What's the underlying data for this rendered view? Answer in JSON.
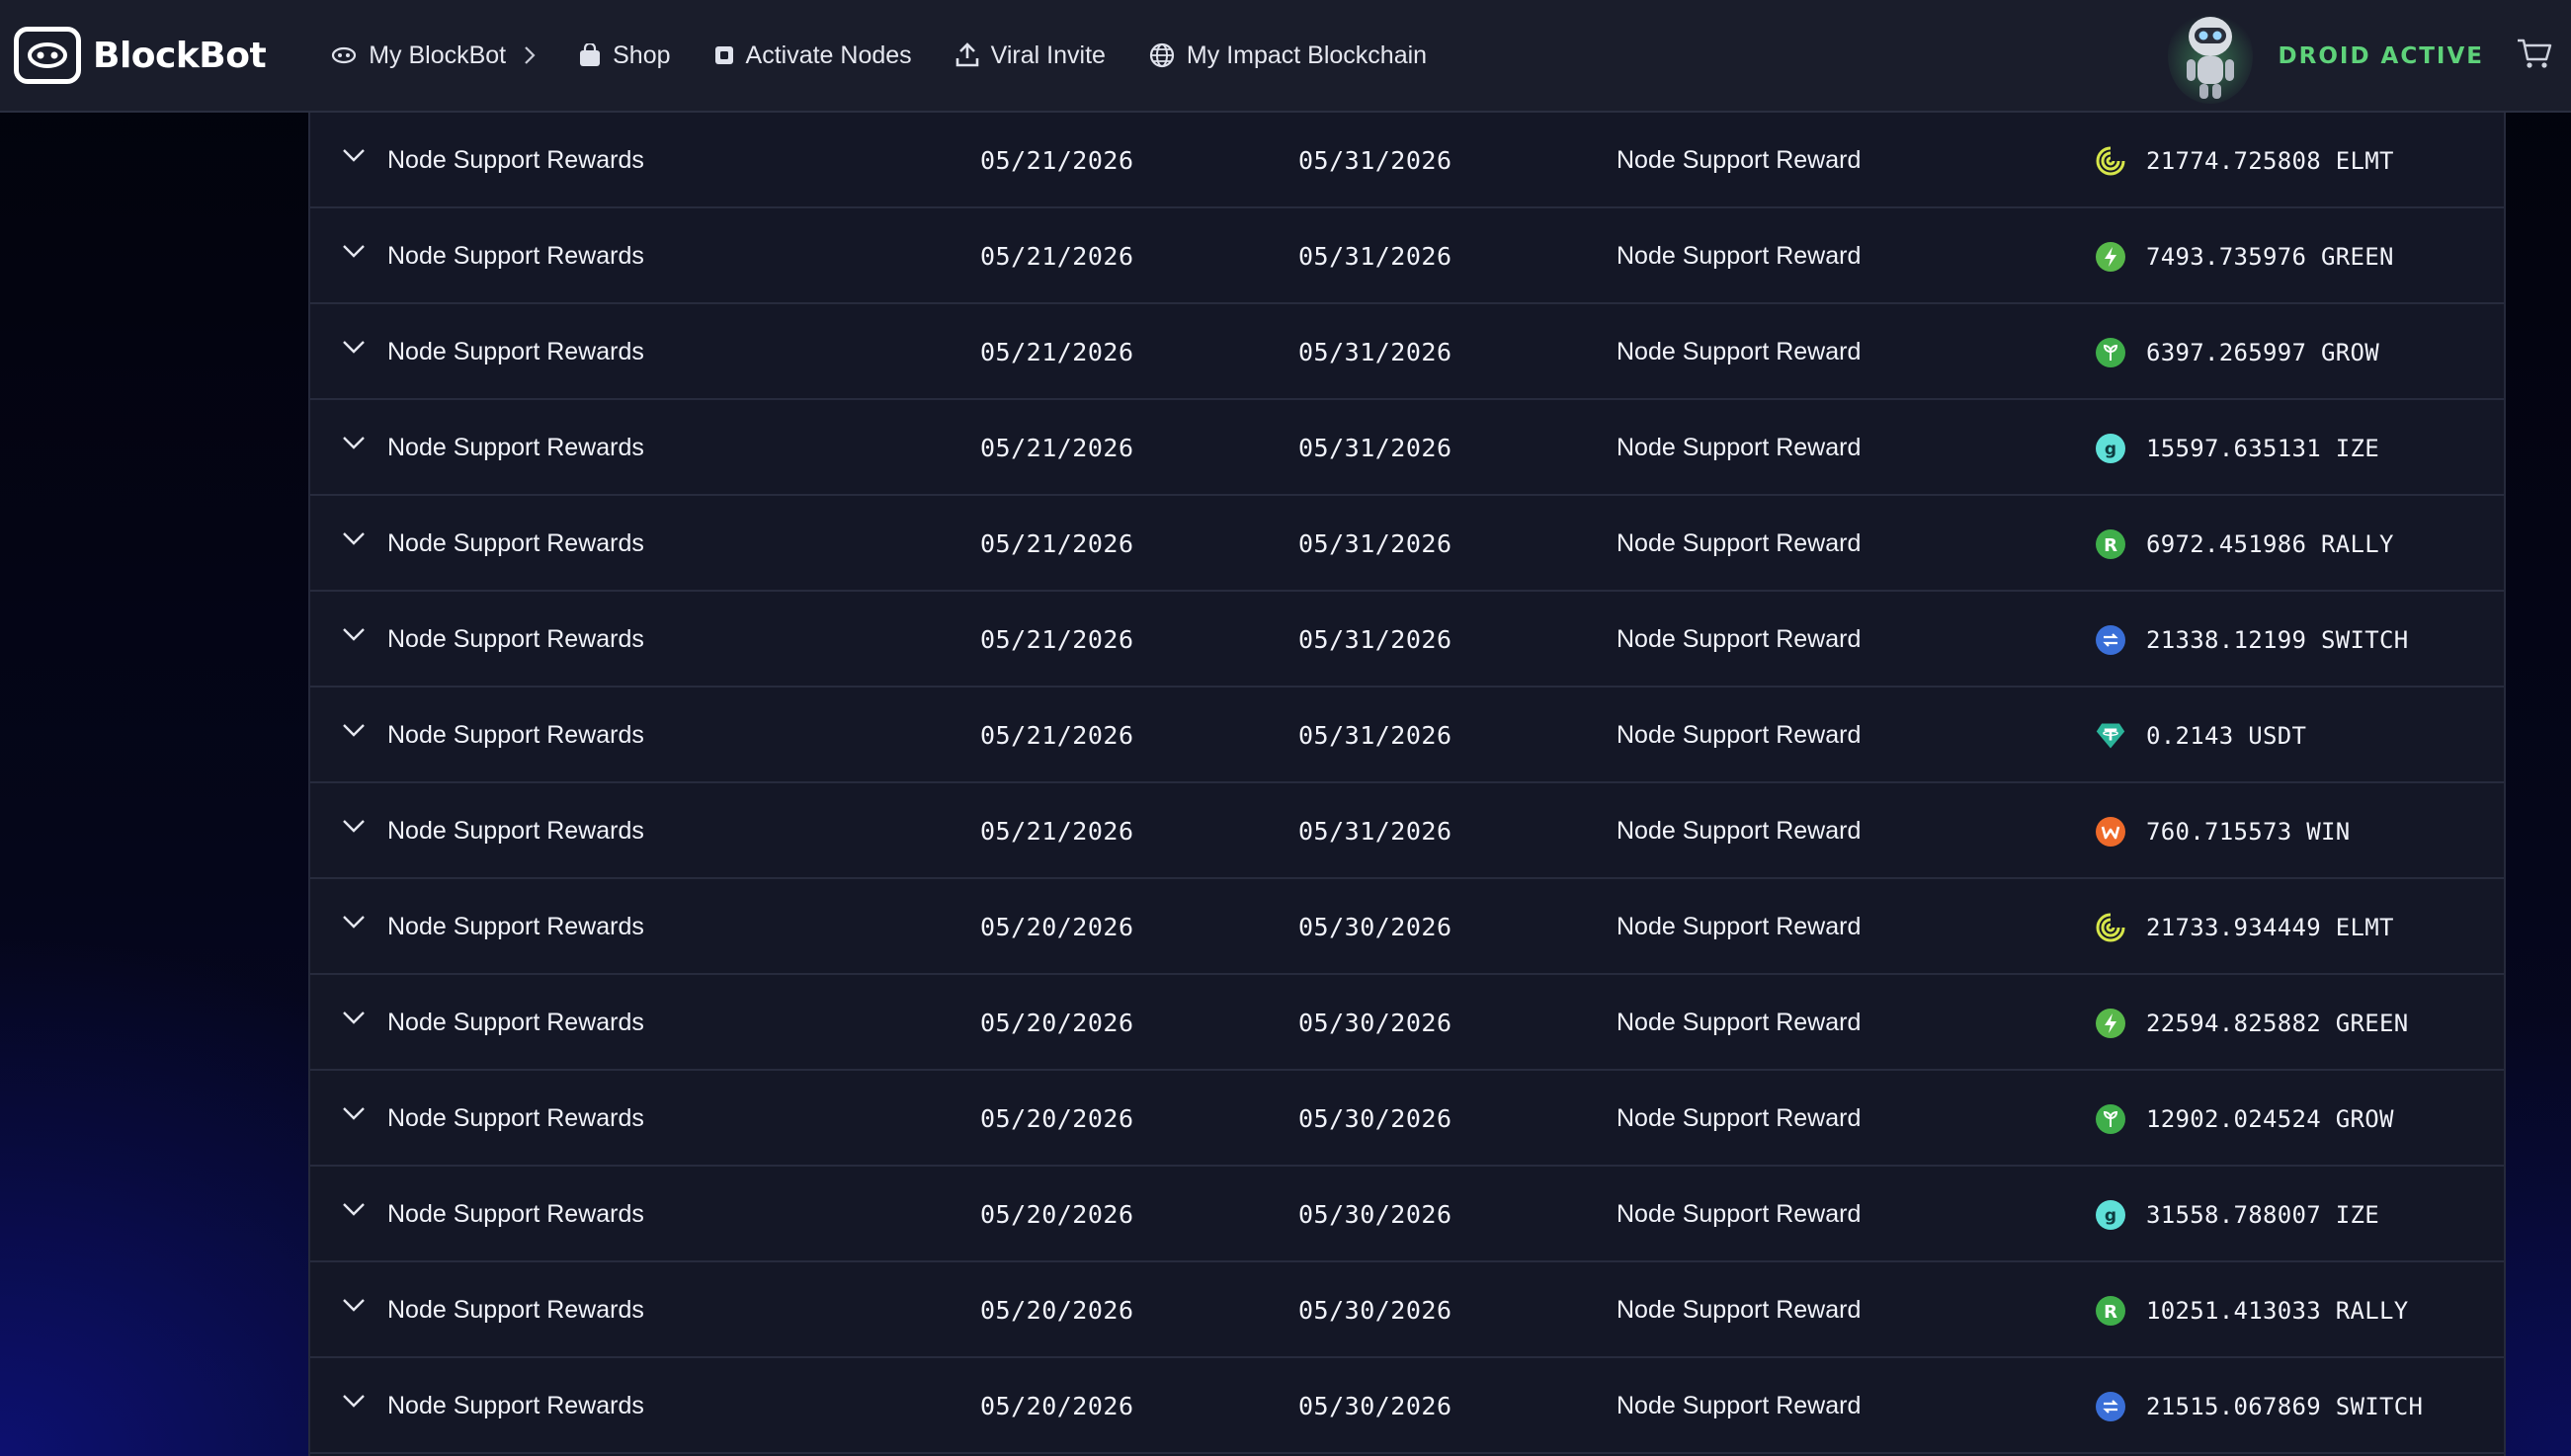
{
  "app": {
    "brand": "BlockBot"
  },
  "nav": {
    "items": [
      {
        "label": "My BlockBot",
        "icon": "eye-icon"
      },
      {
        "label": "Shop",
        "icon": "shopping-bag-icon"
      },
      {
        "label": "Activate Nodes",
        "icon": "node-chip-icon"
      },
      {
        "label": "Viral Invite",
        "icon": "upload-share-icon"
      },
      {
        "label": "My Impact Blockchain",
        "icon": "globe-icon"
      }
    ]
  },
  "status": {
    "droid": "DROID ACTIVE",
    "droid_color": "#5ed27a"
  },
  "colors": {
    "topbar": "#1a1d2b",
    "table": "#141726",
    "ELMT": "#d6e64a",
    "GREEN": "#58b84a",
    "GROW": "#3fae4a",
    "IZE": "#5fe0d8",
    "RALLY": "#3fae4a",
    "SWITCH": "#3a6fd8",
    "USDT": "#2bb59a",
    "WIN": "#ee6a2a"
  },
  "rows": [
    {
      "name": "Node Support Rewards",
      "start": "05/21/2026",
      "end": "05/31/2026",
      "type": "Node Support Reward",
      "amount": "21774.725808 ELMT",
      "token": "ELMT",
      "icon": "elmt-token-icon"
    },
    {
      "name": "Node Support Rewards",
      "start": "05/21/2026",
      "end": "05/31/2026",
      "type": "Node Support Reward",
      "amount": "7493.735976 GREEN",
      "token": "GREEN",
      "icon": "green-token-icon"
    },
    {
      "name": "Node Support Rewards",
      "start": "05/21/2026",
      "end": "05/31/2026",
      "type": "Node Support Reward",
      "amount": "6397.265997 GROW",
      "token": "GROW",
      "icon": "grow-token-icon"
    },
    {
      "name": "Node Support Rewards",
      "start": "05/21/2026",
      "end": "05/31/2026",
      "type": "Node Support Reward",
      "amount": "15597.635131 IZE",
      "token": "IZE",
      "icon": "ize-token-icon"
    },
    {
      "name": "Node Support Rewards",
      "start": "05/21/2026",
      "end": "05/31/2026",
      "type": "Node Support Reward",
      "amount": "6972.451986 RALLY",
      "token": "RALLY",
      "icon": "rally-token-icon"
    },
    {
      "name": "Node Support Rewards",
      "start": "05/21/2026",
      "end": "05/31/2026",
      "type": "Node Support Reward",
      "amount": "21338.12199 SWITCH",
      "token": "SWITCH",
      "icon": "switch-token-icon"
    },
    {
      "name": "Node Support Rewards",
      "start": "05/21/2026",
      "end": "05/31/2026",
      "type": "Node Support Reward",
      "amount": "0.2143 USDT",
      "token": "USDT",
      "icon": "usdt-token-icon"
    },
    {
      "name": "Node Support Rewards",
      "start": "05/21/2026",
      "end": "05/31/2026",
      "type": "Node Support Reward",
      "amount": "760.715573 WIN",
      "token": "WIN",
      "icon": "win-token-icon"
    },
    {
      "name": "Node Support Rewards",
      "start": "05/20/2026",
      "end": "05/30/2026",
      "type": "Node Support Reward",
      "amount": "21733.934449 ELMT",
      "token": "ELMT",
      "icon": "elmt-token-icon"
    },
    {
      "name": "Node Support Rewards",
      "start": "05/20/2026",
      "end": "05/30/2026",
      "type": "Node Support Reward",
      "amount": "22594.825882 GREEN",
      "token": "GREEN",
      "icon": "green-token-icon"
    },
    {
      "name": "Node Support Rewards",
      "start": "05/20/2026",
      "end": "05/30/2026",
      "type": "Node Support Reward",
      "amount": "12902.024524 GROW",
      "token": "GROW",
      "icon": "grow-token-icon"
    },
    {
      "name": "Node Support Rewards",
      "start": "05/20/2026",
      "end": "05/30/2026",
      "type": "Node Support Reward",
      "amount": "31558.788007 IZE",
      "token": "IZE",
      "icon": "ize-token-icon"
    },
    {
      "name": "Node Support Rewards",
      "start": "05/20/2026",
      "end": "05/30/2026",
      "type": "Node Support Reward",
      "amount": "10251.413033 RALLY",
      "token": "RALLY",
      "icon": "rally-token-icon"
    },
    {
      "name": "Node Support Rewards",
      "start": "05/20/2026",
      "end": "05/30/2026",
      "type": "Node Support Reward",
      "amount": "21515.067869 SWITCH",
      "token": "SWITCH",
      "icon": "switch-token-icon"
    }
  ]
}
